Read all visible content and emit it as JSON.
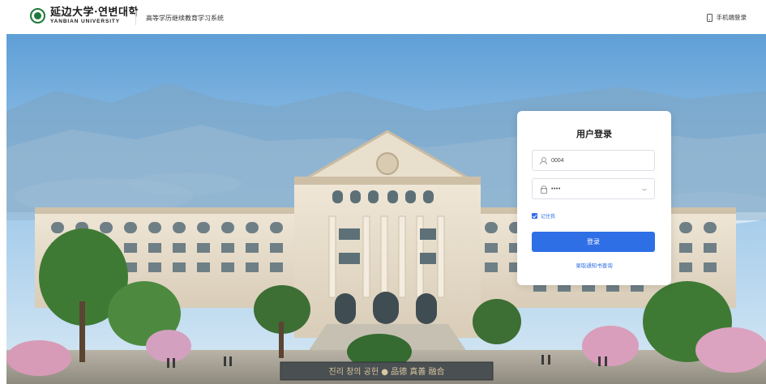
{
  "header": {
    "logo_cn": "延边大学·연변대학",
    "logo_en": "YANBIAN UNIVERSITY",
    "system_title": "高等学历继续教育学习系统",
    "mobile_login_label": "手机端登录",
    "phone_icon": "phone-icon"
  },
  "hero": {
    "plaque_text": "진리 창의 공헌 ● 品德 真善 融合"
  },
  "login": {
    "title": "用户登录",
    "username_value": "0004",
    "password_mask": "••••",
    "remember_label": "记住我",
    "remember_checked": true,
    "submit_label": "登录",
    "admission_query_link": "录取通知书查询",
    "accent_color": "#2f6fe6"
  }
}
